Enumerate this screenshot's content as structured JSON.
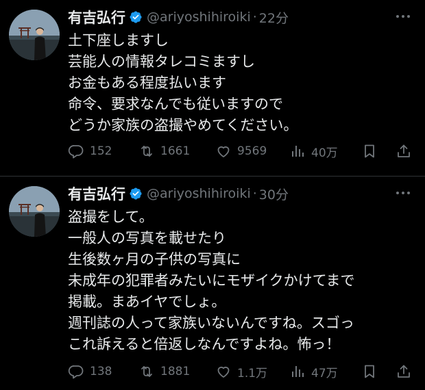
{
  "colors": {
    "background": "#000000",
    "text": "#e7e9ea",
    "secondary_text": "#71767b",
    "verified_badge": "#1d9bf0",
    "divider": "#2f3336"
  },
  "tweets": [
    {
      "author_name": "有吉弘行",
      "handle": "@ariyoshihiroiki",
      "separator": "·",
      "time": "22分",
      "lines": [
        "土下座しますし",
        "芸能人の情報タレコミますし",
        "お金もある程度払います",
        "命令、要求なんでも従いますので",
        "どうか家族の盗撮やめてください。"
      ],
      "replies": "152",
      "reposts": "1661",
      "likes": "9569",
      "views": "40万"
    },
    {
      "author_name": "有吉弘行",
      "handle": "@ariyoshihiroiki",
      "separator": "·",
      "time": "30分",
      "lines": [
        "盗撮をして。",
        "一般人の写真を載せたり",
        "生後数ヶ月の子供の写真に",
        "未成年の犯罪者みたいにモザイクかけてまで",
        "掲載。まあイヤでしょ。",
        "週刊誌の人って家族いないんですね。スゴっ",
        "これ訴えると倍返しなんですよね。怖っ！"
      ],
      "replies": "138",
      "reposts": "1881",
      "likes": "1.1万",
      "views": "47万"
    }
  ],
  "icons": {
    "verified": "verified-badge-icon",
    "more": "more-options-icon",
    "reply": "reply-icon",
    "repost": "repost-icon",
    "like": "like-icon",
    "views": "views-icon",
    "bookmark": "bookmark-icon",
    "share": "share-icon"
  }
}
